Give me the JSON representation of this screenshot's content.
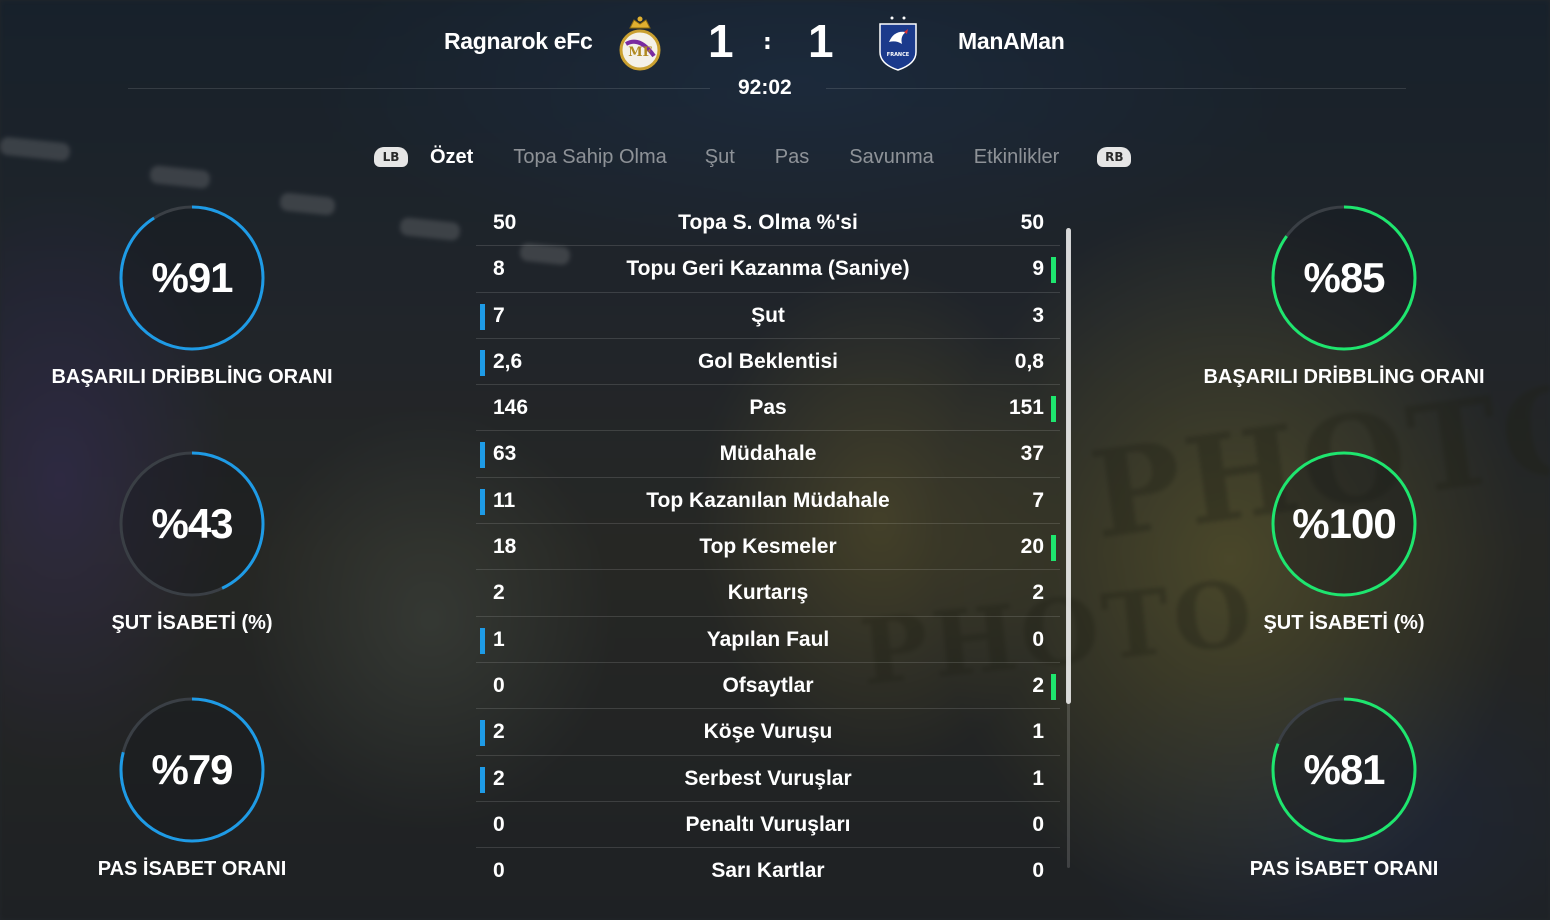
{
  "header": {
    "home_team": "Ragnarok eFc",
    "away_team": "ManAMan",
    "home_score": "1",
    "away_score": "1",
    "separator": ":",
    "clock": "92:02",
    "home_crest_icon": "real-madrid-crest-icon",
    "away_crest_icon": "france-federation-crest-icon"
  },
  "tabs": {
    "left_bumper": "LB",
    "right_bumper": "RB",
    "items": [
      "Özet",
      "Topa Sahip Olma",
      "Şut",
      "Pas",
      "Savunma",
      "Etkinlikler"
    ],
    "active": "Özet"
  },
  "colors": {
    "home_accent": "#1e9be6",
    "away_accent": "#1ee66e",
    "ring_track": "#3a3f45"
  },
  "home_rings": [
    {
      "value": "%91",
      "label": "BAŞARILI DRİBBLİNG ORANI",
      "fraction": 0.91
    },
    {
      "value": "%43",
      "label": "ŞUT İSABETİ (%)",
      "fraction": 0.43
    },
    {
      "value": "%79",
      "label": "PAS İSABET ORANI",
      "fraction": 0.79
    }
  ],
  "away_rings": [
    {
      "value": "%85",
      "label": "BAŞARILI DRİBBLİNG ORANI",
      "fraction": 0.85
    },
    {
      "value": "%100",
      "label": "ŞUT İSABETİ (%)",
      "fraction": 1.0
    },
    {
      "value": "%81",
      "label": "PAS İSABET ORANI",
      "fraction": 0.81
    }
  ],
  "stats": [
    {
      "name": "Topa S. Olma %'si",
      "home": "50",
      "away": "50",
      "leader": "none"
    },
    {
      "name": "Topu Geri Kazanma (Saniye)",
      "home": "8",
      "away": "9",
      "leader": "away"
    },
    {
      "name": "Şut",
      "home": "7",
      "away": "3",
      "leader": "home"
    },
    {
      "name": "Gol Beklentisi",
      "home": "2,6",
      "away": "0,8",
      "leader": "home"
    },
    {
      "name": "Pas",
      "home": "146",
      "away": "151",
      "leader": "away"
    },
    {
      "name": "Müdahale",
      "home": "63",
      "away": "37",
      "leader": "home"
    },
    {
      "name": "Top Kazanılan Müdahale",
      "home": "11",
      "away": "7",
      "leader": "home"
    },
    {
      "name": "Top Kesmeler",
      "home": "18",
      "away": "20",
      "leader": "away"
    },
    {
      "name": "Kurtarış",
      "home": "2",
      "away": "2",
      "leader": "none"
    },
    {
      "name": "Yapılan Faul",
      "home": "1",
      "away": "0",
      "leader": "home"
    },
    {
      "name": "Ofsaytlar",
      "home": "0",
      "away": "2",
      "leader": "away"
    },
    {
      "name": "Köşe Vuruşu",
      "home": "2",
      "away": "1",
      "leader": "home"
    },
    {
      "name": "Serbest Vuruşlar",
      "home": "2",
      "away": "1",
      "leader": "home"
    },
    {
      "name": "Penaltı Vuruşları",
      "home": "0",
      "away": "0",
      "leader": "none"
    },
    {
      "name": "Sarı Kartlar",
      "home": "0",
      "away": "0",
      "leader": "none"
    }
  ],
  "background": {
    "watermark_text": "PHOTO"
  }
}
